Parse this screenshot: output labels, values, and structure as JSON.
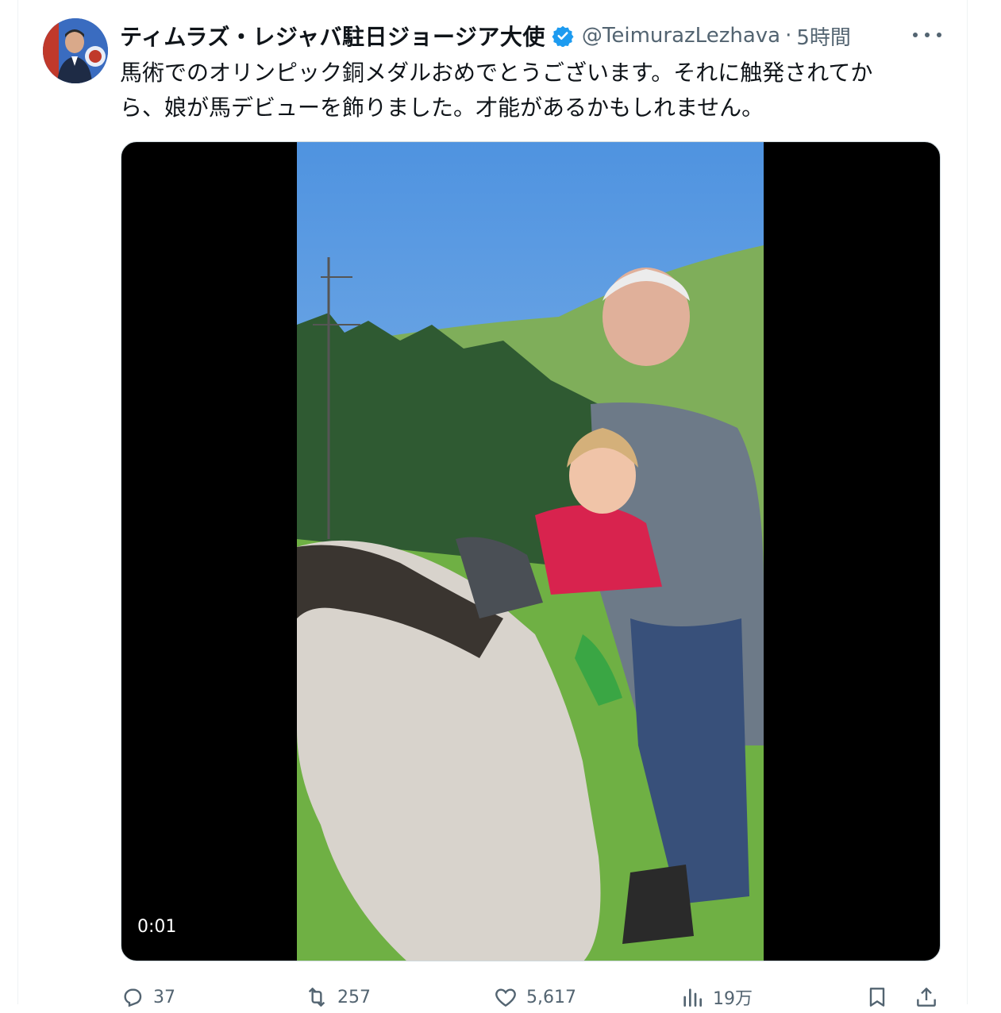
{
  "tweet": {
    "display_name": "ティムラズ・レジャバ駐日ジョージア大使",
    "handle": "@TeimurazLezhava",
    "separator": "·",
    "time": "5時間",
    "text_lines": [
      "馬術でのオリンピック銅メダルおめでとうございます。それに触発されてか",
      "ら、娘が馬デビューを飾りました。才能があるかもしれません。"
    ]
  },
  "video": {
    "timestamp": "0:01"
  },
  "actions": {
    "replies": "37",
    "reposts": "257",
    "likes": "5,617",
    "views": "19万"
  },
  "icons": {
    "avatar": "profile-photo",
    "verified": "verified-badge-icon",
    "more": "more-icon",
    "reply": "reply-icon",
    "repost": "repost-icon",
    "like": "heart-icon",
    "views": "views-icon",
    "bookmark": "bookmark-icon",
    "share": "share-icon"
  },
  "colors": {
    "text": "#0f1419",
    "secondary": "#536471",
    "verified": "#1d9bf0"
  }
}
